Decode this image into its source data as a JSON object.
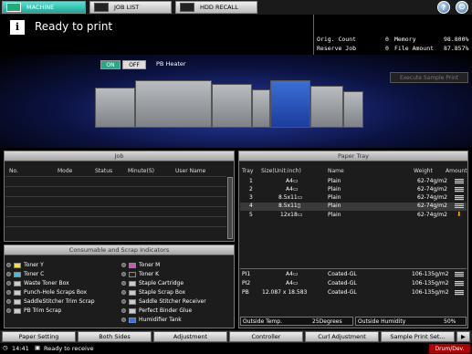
{
  "tabs": {
    "machine": "MACHINE",
    "job_list": "JOB LIST",
    "hdd_recall": "HDD RECALL"
  },
  "top_buttons": {
    "help": "?",
    "power": "⏻"
  },
  "status": {
    "icon": "i",
    "message": "Ready to print"
  },
  "counters": {
    "orig_count_label": "Orig. Count",
    "orig_count_value": "0",
    "memory_label": "Memory",
    "memory_value": "98.800%",
    "reserve_job_label": "Reserve Job",
    "reserve_job_value": "0",
    "file_amount_label": "File Amount",
    "file_amount_value": "87.857%"
  },
  "machine": {
    "on_label": "ON",
    "off_label": "OFF",
    "pb_heater_label": "PB Heater",
    "execute_sample_label": "Execute Sample Print"
  },
  "job_panel": {
    "title": "Job",
    "columns": [
      "No.",
      "Mode",
      "Status",
      "Minute(S)",
      "User Name"
    ]
  },
  "paper_tray": {
    "title": "Paper Tray",
    "columns": [
      "Tray",
      "Size(Unit:inch)",
      "Name",
      "Weight",
      "Amount"
    ],
    "rows": [
      {
        "tray": "1",
        "size": "A4▭",
        "name": "Plain",
        "weight": "62-74g/m2",
        "amount": "bar"
      },
      {
        "tray": "2",
        "size": "A4▭",
        "name": "Plain",
        "weight": "62-74g/m2",
        "amount": "bar"
      },
      {
        "tray": "3",
        "size": "8.5x11▭",
        "name": "Plain",
        "weight": "62-74g/m2",
        "amount": "bar"
      },
      {
        "tray": "4",
        "size": "8.5x11▯",
        "name": "Plain",
        "weight": "62-74g/m2",
        "amount": "bar"
      },
      {
        "tray": "5",
        "size": "12x18▭",
        "name": "Plain",
        "weight": "62-74g/m2",
        "amount": "warning"
      }
    ],
    "inserter_rows": [
      {
        "tray": "PI1",
        "size": "A4▭",
        "name": "Coated-GL",
        "weight": "106-135g/m2"
      },
      {
        "tray": "PI2",
        "size": "A4▭",
        "name": "Coated-GL",
        "weight": "106-135g/m2"
      },
      {
        "tray": "PB",
        "size": "12.087 x 18.583",
        "name": "Coated-GL",
        "weight": "106-135g/m2"
      }
    ],
    "outside_temp_label": "Outside Temp.",
    "outside_temp_value": "25Degrees",
    "outside_humidity_label": "Outside Humidity",
    "outside_humidity_value": "50%"
  },
  "consumables": {
    "title": "Consumable and Scrap Indicators",
    "left": [
      "Toner Y",
      "Toner C",
      "Waste Toner Box",
      "Punch-Hole Scraps Box",
      "SaddleStitcher Trim Scrap",
      "PB Trim Scrap"
    ],
    "right": [
      "Toner M",
      "Toner K",
      "Staple Cartridge",
      "Staple Scrap Box",
      "Saddle Stitcher Receiver",
      "Perfect Binder Glue",
      "Humidifier Tank"
    ]
  },
  "bottom_nav": [
    "Paper Setting",
    "Both Sides",
    "Adjustment",
    "Controller",
    "Curl Adjustment",
    "Sample Print Set..."
  ],
  "statusbar": {
    "time": "14:41",
    "message": "Ready to receive",
    "drum_label": "Drum/Dev."
  }
}
